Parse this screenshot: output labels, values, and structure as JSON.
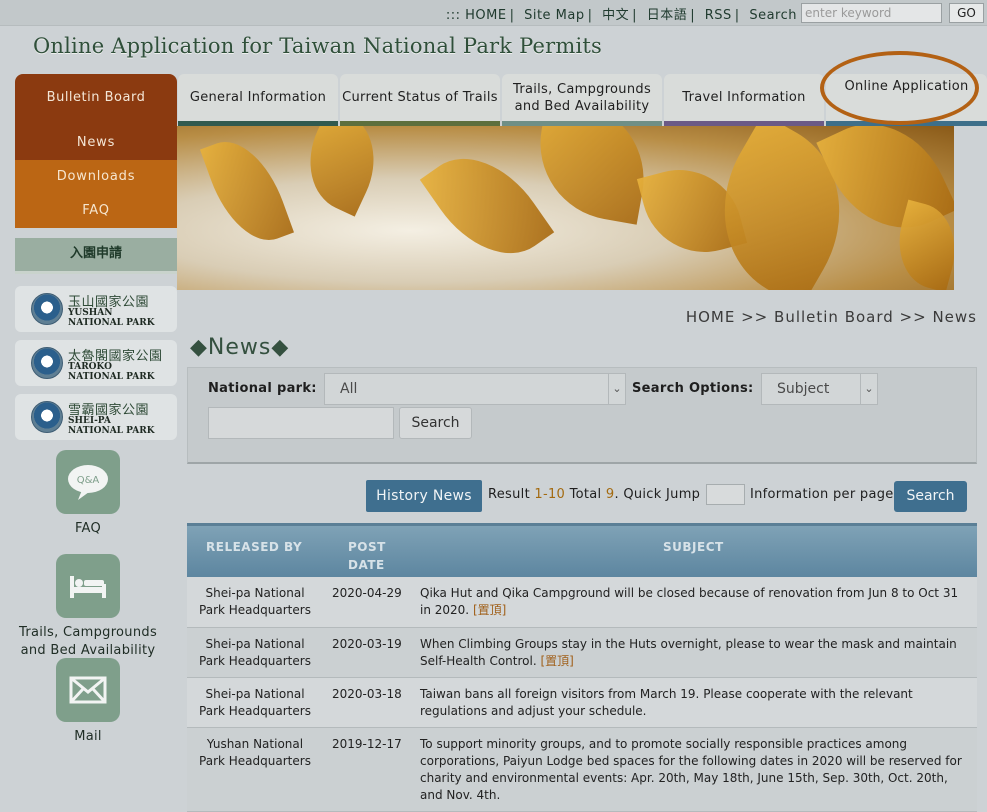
{
  "topbar": {
    "links": [
      "HOME",
      "Site Map",
      "中文",
      "日本語",
      "RSS",
      "Search"
    ],
    "prefix": ":::",
    "search_placeholder": "enter keyword",
    "go_label": "GO"
  },
  "site_title": "Online Application for Taiwan National Park Permits",
  "nav": {
    "tabs": [
      "General Information",
      "Current Status of Trails",
      "Trails, Campgrounds and Bed Availability",
      "Travel Information",
      "Online Application"
    ]
  },
  "sidebar": {
    "header": "Bulletin Board",
    "items": [
      "News",
      "Downloads",
      "FAQ"
    ],
    "apply_header": "入園申請",
    "parks": [
      {
        "zh": "玉山國家公園",
        "en": "YUSHAN\nNATIONAL PARK"
      },
      {
        "zh": "太魯閣國家公園",
        "en": "TAROKO\nNATIONAL PARK"
      },
      {
        "zh": "雪霸國家公園",
        "en": "SHEI-PA\nNATIONAL PARK"
      }
    ],
    "quick_links": [
      {
        "label": "FAQ",
        "icon": "qa-icon",
        "icon_text": "Q&A"
      },
      {
        "label": "Trails, Campgrounds\nand Bed Availability",
        "icon": "bed-icon"
      },
      {
        "label": "Mail",
        "icon": "mail-icon"
      }
    ]
  },
  "breadcrumb": "HOME >> Bulletin Board >> News",
  "page_heading": "◆News◆",
  "filter": {
    "park_label": "National park:",
    "park_value": "All",
    "options_label": "Search Options:",
    "options_value": "Subject",
    "keyword_value": "",
    "search_label": "Search"
  },
  "pager": {
    "history_label": "History News",
    "result_label": "Result",
    "result_range": "1-10",
    "total_label": "Total",
    "total": "9",
    "quick_jump_label": "Quick Jump",
    "per_page_label": "Information per page",
    "search_label": "Search"
  },
  "table": {
    "headers": {
      "by": "RELEASED BY",
      "date": "POST\nDATE",
      "subject": "SUBJECT"
    },
    "rows": [
      {
        "by": "Shei-pa National\nPark Headquarters",
        "date": "2020-04-29",
        "subject": "Qika Hut and Qika Campground will be closed because of renovation from Jun 8 to Oct 31 in 2020.",
        "pin": "[置頂]"
      },
      {
        "by": "Shei-pa National\nPark Headquarters",
        "date": "2020-03-19",
        "subject": "When Climbing Groups stay in the Huts overnight, please to wear the mask and maintain Self-Health Control.",
        "pin": "[置頂]"
      },
      {
        "by": "Shei-pa National\nPark Headquarters",
        "date": "2020-03-18",
        "subject": "Taiwan bans all foreign visitors from March 19. Please cooperate with the relevant regulations and adjust your schedule.",
        "pin": ""
      },
      {
        "by": "Yushan National\nPark Headquarters",
        "date": "2019-12-17",
        "subject": "To support minority groups, and to promote socially responsible practices among corporations, Paiyun Lodge bed spaces for the following dates in 2020 will be reserved for charity and environmental events: Apr. 20th, May 18th, June 15th, Sep. 30th, Oct. 20th, and Nov. 4th.",
        "pin": ""
      }
    ]
  },
  "colors": {
    "bulletin": "#8b3a10",
    "sub_menu": "#bb6614",
    "accent_blue": "#3f6f8f",
    "title_green": "#2f4f3a",
    "highlight_ring": "#b36114"
  }
}
